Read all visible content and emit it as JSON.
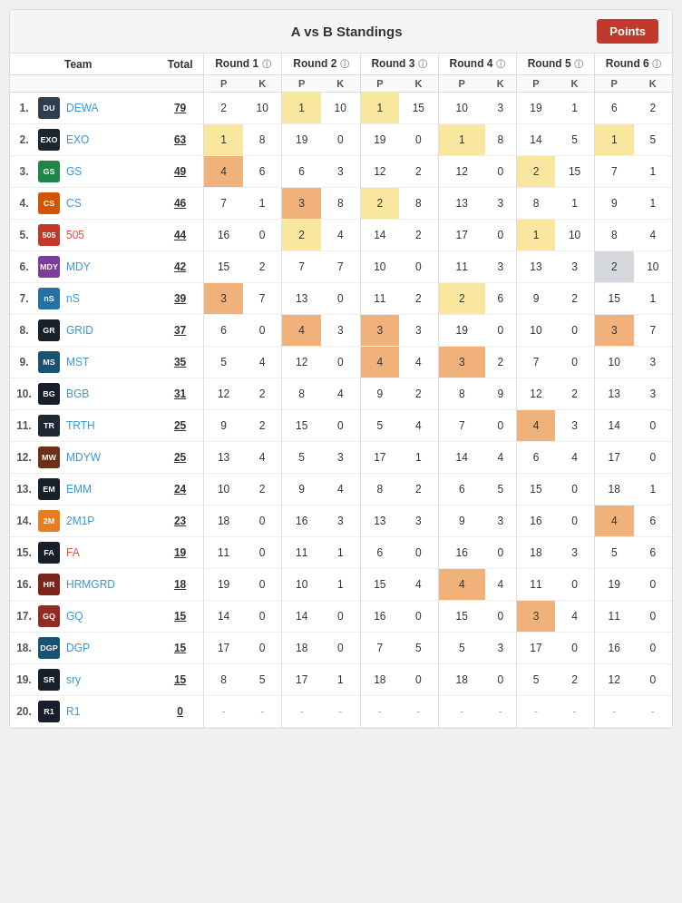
{
  "header": {
    "title": "A vs B Standings",
    "points_btn": "Points"
  },
  "columns": {
    "team": "Team",
    "total": "Total",
    "rounds": [
      "Round 1",
      "Round 2",
      "Round 3",
      "Round 4",
      "Round 5",
      "Round 6"
    ],
    "sub": [
      "P",
      "K"
    ]
  },
  "rows": [
    {
      "rank": "1.",
      "logo_color": "#2c3e50",
      "logo_text": "DU",
      "name": "DEWA",
      "name_color": "blue",
      "total": "79",
      "r1p": "2",
      "r1k": "10",
      "r1p_hl": "",
      "r1k_hl": "",
      "r2p": "1",
      "r2k": "10",
      "r2p_hl": "yellow",
      "r2k_hl": "",
      "r3p": "1",
      "r3k": "15",
      "r3p_hl": "yellow",
      "r3k_hl": "",
      "r4p": "10",
      "r4k": "3",
      "r4p_hl": "",
      "r4k_hl": "",
      "r5p": "19",
      "r5k": "1",
      "r5p_hl": "",
      "r5k_hl": "",
      "r6p": "6",
      "r6k": "2",
      "r6p_hl": "",
      "r6k_hl": ""
    },
    {
      "rank": "2.",
      "logo_color": "#1a252f",
      "logo_text": "EXO",
      "name": "EXO",
      "name_color": "blue",
      "total": "63",
      "r1p": "1",
      "r1k": "8",
      "r1p_hl": "yellow",
      "r1k_hl": "",
      "r2p": "19",
      "r2k": "0",
      "r2p_hl": "",
      "r2k_hl": "",
      "r3p": "19",
      "r3k": "0",
      "r3p_hl": "",
      "r3k_hl": "",
      "r4p": "1",
      "r4k": "8",
      "r4p_hl": "yellow",
      "r4k_hl": "",
      "r5p": "14",
      "r5k": "5",
      "r5p_hl": "",
      "r5k_hl": "",
      "r6p": "1",
      "r6k": "5",
      "r6p_hl": "yellow",
      "r6k_hl": ""
    },
    {
      "rank": "3.",
      "logo_color": "#1e8449",
      "logo_text": "GS",
      "name": "GS",
      "name_color": "blue",
      "total": "49",
      "r1p": "4",
      "r1k": "6",
      "r1p_hl": "orange",
      "r1k_hl": "",
      "r2p": "6",
      "r2k": "3",
      "r2p_hl": "",
      "r2k_hl": "",
      "r3p": "12",
      "r3k": "2",
      "r3p_hl": "",
      "r3k_hl": "",
      "r4p": "12",
      "r4k": "0",
      "r4p_hl": "",
      "r4k_hl": "",
      "r5p": "2",
      "r5k": "15",
      "r5p_hl": "yellow",
      "r5k_hl": "",
      "r6p": "7",
      "r6k": "1",
      "r6p_hl": "",
      "r6k_hl": ""
    },
    {
      "rank": "4.",
      "logo_color": "#d35400",
      "logo_text": "CS",
      "name": "CS",
      "name_color": "blue",
      "total": "46",
      "r1p": "7",
      "r1k": "1",
      "r1p_hl": "",
      "r1k_hl": "",
      "r2p": "3",
      "r2k": "8",
      "r2p_hl": "orange",
      "r2k_hl": "",
      "r3p": "2",
      "r3k": "8",
      "r3p_hl": "yellow",
      "r3k_hl": "",
      "r4p": "13",
      "r4k": "3",
      "r4p_hl": "",
      "r4k_hl": "",
      "r5p": "8",
      "r5k": "1",
      "r5p_hl": "",
      "r5k_hl": "",
      "r6p": "9",
      "r6k": "1",
      "r6p_hl": "",
      "r6k_hl": ""
    },
    {
      "rank": "5.",
      "logo_color": "#c0392b",
      "logo_text": "505",
      "name": "505",
      "name_color": "red",
      "total": "44",
      "r1p": "16",
      "r1k": "0",
      "r1p_hl": "",
      "r1k_hl": "",
      "r2p": "2",
      "r2k": "4",
      "r2p_hl": "yellow",
      "r2k_hl": "",
      "r3p": "14",
      "r3k": "2",
      "r3p_hl": "",
      "r3k_hl": "",
      "r4p": "17",
      "r4k": "0",
      "r4p_hl": "",
      "r4k_hl": "",
      "r5p": "1",
      "r5k": "10",
      "r5p_hl": "yellow",
      "r5k_hl": "",
      "r6p": "8",
      "r6k": "4",
      "r6p_hl": "",
      "r6k_hl": ""
    },
    {
      "rank": "6.",
      "logo_color": "#7d3c98",
      "logo_text": "MDY",
      "name": "MDY",
      "name_color": "blue",
      "total": "42",
      "r1p": "15",
      "r1k": "2",
      "r1p_hl": "",
      "r1k_hl": "",
      "r2p": "7",
      "r2k": "7",
      "r2p_hl": "",
      "r2k_hl": "",
      "r3p": "10",
      "r3k": "0",
      "r3p_hl": "",
      "r3k_hl": "",
      "r4p": "11",
      "r4k": "3",
      "r4p_hl": "",
      "r4k_hl": "",
      "r5p": "13",
      "r5k": "3",
      "r5p_hl": "",
      "r5k_hl": "",
      "r6p": "2",
      "r6k": "10",
      "r6p_hl": "gray",
      "r6k_hl": ""
    },
    {
      "rank": "7.",
      "logo_color": "#2471a3",
      "logo_text": "nS",
      "name": "nS",
      "name_color": "blue",
      "total": "39",
      "r1p": "3",
      "r1k": "7",
      "r1p_hl": "orange",
      "r1k_hl": "",
      "r2p": "13",
      "r2k": "0",
      "r2p_hl": "",
      "r2k_hl": "",
      "r3p": "11",
      "r3k": "2",
      "r3p_hl": "",
      "r3k_hl": "",
      "r4p": "2",
      "r4k": "6",
      "r4p_hl": "yellow",
      "r4k_hl": "",
      "r5p": "9",
      "r5k": "2",
      "r5p_hl": "",
      "r5k_hl": "",
      "r6p": "15",
      "r6k": "1",
      "r6p_hl": "",
      "r6k_hl": ""
    },
    {
      "rank": "8.",
      "logo_color": "#17202a",
      "logo_text": "GR",
      "name": "GRID",
      "name_color": "blue",
      "total": "37",
      "r1p": "6",
      "r1k": "0",
      "r1p_hl": "",
      "r1k_hl": "",
      "r2p": "4",
      "r2k": "3",
      "r2p_hl": "orange",
      "r2k_hl": "",
      "r3p": "3",
      "r3k": "3",
      "r3p_hl": "orange",
      "r3k_hl": "",
      "r4p": "19",
      "r4k": "0",
      "r4p_hl": "",
      "r4k_hl": "",
      "r5p": "10",
      "r5k": "0",
      "r5p_hl": "",
      "r5k_hl": "",
      "r6p": "3",
      "r6k": "7",
      "r6p_hl": "orange",
      "r6k_hl": ""
    },
    {
      "rank": "9.",
      "logo_color": "#1a5276",
      "logo_text": "MS",
      "name": "MST",
      "name_color": "blue",
      "total": "35",
      "r1p": "5",
      "r1k": "4",
      "r1p_hl": "",
      "r1k_hl": "",
      "r2p": "12",
      "r2k": "0",
      "r2p_hl": "",
      "r2k_hl": "",
      "r3p": "4",
      "r3k": "4",
      "r3p_hl": "orange",
      "r3k_hl": "",
      "r4p": "3",
      "r4k": "2",
      "r4p_hl": "orange",
      "r4k_hl": "",
      "r5p": "7",
      "r5k": "0",
      "r5p_hl": "",
      "r5k_hl": "",
      "r6p": "10",
      "r6k": "3",
      "r6p_hl": "",
      "r6k_hl": ""
    },
    {
      "rank": "10.",
      "logo_color": "#17202a",
      "logo_text": "BG",
      "name": "BGB",
      "name_color": "blue",
      "total": "31",
      "r1p": "12",
      "r1k": "2",
      "r1p_hl": "",
      "r1k_hl": "",
      "r2p": "8",
      "r2k": "4",
      "r2p_hl": "",
      "r2k_hl": "",
      "r3p": "9",
      "r3k": "2",
      "r3p_hl": "",
      "r3k_hl": "",
      "r4p": "8",
      "r4k": "9",
      "r4p_hl": "",
      "r4k_hl": "",
      "r5p": "12",
      "r5k": "2",
      "r5p_hl": "",
      "r5k_hl": "",
      "r6p": "13",
      "r6k": "3",
      "r6p_hl": "",
      "r6k_hl": ""
    },
    {
      "rank": "11.",
      "logo_color": "#1c2833",
      "logo_text": "TR",
      "name": "TRTH",
      "name_color": "blue",
      "total": "25",
      "r1p": "9",
      "r1k": "2",
      "r1p_hl": "",
      "r1k_hl": "",
      "r2p": "15",
      "r2k": "0",
      "r2p_hl": "",
      "r2k_hl": "",
      "r3p": "5",
      "r3k": "4",
      "r3p_hl": "",
      "r3k_hl": "",
      "r4p": "7",
      "r4k": "0",
      "r4p_hl": "",
      "r4k_hl": "",
      "r5p": "4",
      "r5k": "3",
      "r5p_hl": "orange",
      "r5k_hl": "",
      "r6p": "14",
      "r6k": "0",
      "r6p_hl": "",
      "r6k_hl": ""
    },
    {
      "rank": "12.",
      "logo_color": "#6e2f1a",
      "logo_text": "MW",
      "name": "MDYW",
      "name_color": "blue",
      "total": "25",
      "r1p": "13",
      "r1k": "4",
      "r1p_hl": "",
      "r1k_hl": "",
      "r2p": "5",
      "r2k": "3",
      "r2p_hl": "",
      "r2k_hl": "",
      "r3p": "17",
      "r3k": "1",
      "r3p_hl": "",
      "r3k_hl": "",
      "r4p": "14",
      "r4k": "4",
      "r4p_hl": "",
      "r4k_hl": "",
      "r5p": "6",
      "r5k": "4",
      "r5p_hl": "",
      "r5k_hl": "",
      "r6p": "17",
      "r6k": "0",
      "r6p_hl": "",
      "r6k_hl": ""
    },
    {
      "rank": "13.",
      "logo_color": "#17202a",
      "logo_text": "EM",
      "name": "EMM",
      "name_color": "blue",
      "total": "24",
      "r1p": "10",
      "r1k": "2",
      "r1p_hl": "",
      "r1k_hl": "",
      "r2p": "9",
      "r2k": "4",
      "r2p_hl": "",
      "r2k_hl": "",
      "r3p": "8",
      "r3k": "2",
      "r3p_hl": "",
      "r3k_hl": "",
      "r4p": "6",
      "r4k": "5",
      "r4p_hl": "",
      "r4k_hl": "",
      "r5p": "15",
      "r5k": "0",
      "r5p_hl": "",
      "r5k_hl": "",
      "r6p": "18",
      "r6k": "1",
      "r6p_hl": "",
      "r6k_hl": ""
    },
    {
      "rank": "14.",
      "logo_color": "#e67e22",
      "logo_text": "2M",
      "name": "2M1P",
      "name_color": "blue",
      "total": "23",
      "r1p": "18",
      "r1k": "0",
      "r1p_hl": "",
      "r1k_hl": "",
      "r2p": "16",
      "r2k": "3",
      "r2p_hl": "",
      "r2k_hl": "",
      "r3p": "13",
      "r3k": "3",
      "r3p_hl": "",
      "r3k_hl": "",
      "r4p": "9",
      "r4k": "3",
      "r4p_hl": "",
      "r4k_hl": "",
      "r5p": "16",
      "r5k": "0",
      "r5p_hl": "",
      "r5k_hl": "",
      "r6p": "4",
      "r6k": "6",
      "r6p_hl": "orange",
      "r6k_hl": ""
    },
    {
      "rank": "15.",
      "logo_color": "#17202a",
      "logo_text": "FA",
      "name": "FA",
      "name_color": "red",
      "total": "19",
      "r1p": "11",
      "r1k": "0",
      "r1p_hl": "",
      "r1k_hl": "",
      "r2p": "11",
      "r2k": "1",
      "r2p_hl": "",
      "r2k_hl": "",
      "r3p": "6",
      "r3k": "0",
      "r3p_hl": "",
      "r3k_hl": "",
      "r4p": "16",
      "r4k": "0",
      "r4p_hl": "",
      "r4k_hl": "",
      "r5p": "18",
      "r5k": "3",
      "r5p_hl": "",
      "r5k_hl": "",
      "r6p": "5",
      "r6k": "6",
      "r6p_hl": "",
      "r6k_hl": ""
    },
    {
      "rank": "16.",
      "logo_color": "#7b241c",
      "logo_text": "HR",
      "name": "HRMGRD",
      "name_color": "blue",
      "total": "18",
      "r1p": "19",
      "r1k": "0",
      "r1p_hl": "",
      "r1k_hl": "",
      "r2p": "10",
      "r2k": "1",
      "r2p_hl": "",
      "r2k_hl": "",
      "r3p": "15",
      "r3k": "4",
      "r3p_hl": "",
      "r3k_hl": "",
      "r4p": "4",
      "r4k": "4",
      "r4p_hl": "orange",
      "r4k_hl": "",
      "r5p": "11",
      "r5k": "0",
      "r5p_hl": "",
      "r5k_hl": "",
      "r6p": "19",
      "r6k": "0",
      "r6p_hl": "",
      "r6k_hl": ""
    },
    {
      "rank": "17.",
      "logo_color": "#922b21",
      "logo_text": "GQ",
      "name": "GQ",
      "name_color": "blue",
      "total": "15",
      "r1p": "14",
      "r1k": "0",
      "r1p_hl": "",
      "r1k_hl": "",
      "r2p": "14",
      "r2k": "0",
      "r2p_hl": "",
      "r2k_hl": "",
      "r3p": "16",
      "r3k": "0",
      "r3p_hl": "",
      "r3k_hl": "",
      "r4p": "15",
      "r4k": "0",
      "r4p_hl": "",
      "r4k_hl": "",
      "r5p": "3",
      "r5k": "4",
      "r5p_hl": "orange",
      "r5k_hl": "",
      "r6p": "11",
      "r6k": "0",
      "r6p_hl": "",
      "r6k_hl": ""
    },
    {
      "rank": "18.",
      "logo_color": "#1a5276",
      "logo_text": "DGP",
      "name": "DGP",
      "name_color": "blue",
      "total": "15",
      "r1p": "17",
      "r1k": "0",
      "r1p_hl": "",
      "r1k_hl": "",
      "r2p": "18",
      "r2k": "0",
      "r2p_hl": "",
      "r2k_hl": "",
      "r3p": "7",
      "r3k": "5",
      "r3p_hl": "",
      "r3k_hl": "",
      "r4p": "5",
      "r4k": "3",
      "r4p_hl": "",
      "r4k_hl": "",
      "r5p": "17",
      "r5k": "0",
      "r5p_hl": "",
      "r5k_hl": "",
      "r6p": "16",
      "r6k": "0",
      "r6p_hl": "",
      "r6k_hl": ""
    },
    {
      "rank": "19.",
      "logo_color": "#17202a",
      "logo_text": "SR",
      "name": "sry",
      "name_color": "blue",
      "total": "15",
      "r1p": "8",
      "r1k": "5",
      "r1p_hl": "",
      "r1k_hl": "",
      "r2p": "17",
      "r2k": "1",
      "r2p_hl": "",
      "r2k_hl": "",
      "r3p": "18",
      "r3k": "0",
      "r3p_hl": "",
      "r3k_hl": "",
      "r4p": "18",
      "r4k": "0",
      "r4p_hl": "",
      "r4k_hl": "",
      "r5p": "5",
      "r5k": "2",
      "r5p_hl": "",
      "r5k_hl": "",
      "r6p": "12",
      "r6k": "0",
      "r6p_hl": "",
      "r6k_hl": ""
    },
    {
      "rank": "20.",
      "logo_color": "#17202a",
      "logo_text": "R1",
      "name": "R1",
      "name_color": "blue",
      "total": "0",
      "r1p": "-",
      "r1k": "-",
      "r1p_hl": "",
      "r1k_hl": "",
      "r2p": "-",
      "r2k": "-",
      "r2p_hl": "",
      "r2k_hl": "",
      "r3p": "-",
      "r3k": "-",
      "r3p_hl": "",
      "r3k_hl": "",
      "r4p": "-",
      "r4k": "-",
      "r4p_hl": "",
      "r4k_hl": "",
      "r5p": "-",
      "r5k": "-",
      "r5p_hl": "",
      "r5k_hl": "",
      "r6p": "-",
      "r6k": "-",
      "r6p_hl": "",
      "r6k_hl": ""
    }
  ]
}
